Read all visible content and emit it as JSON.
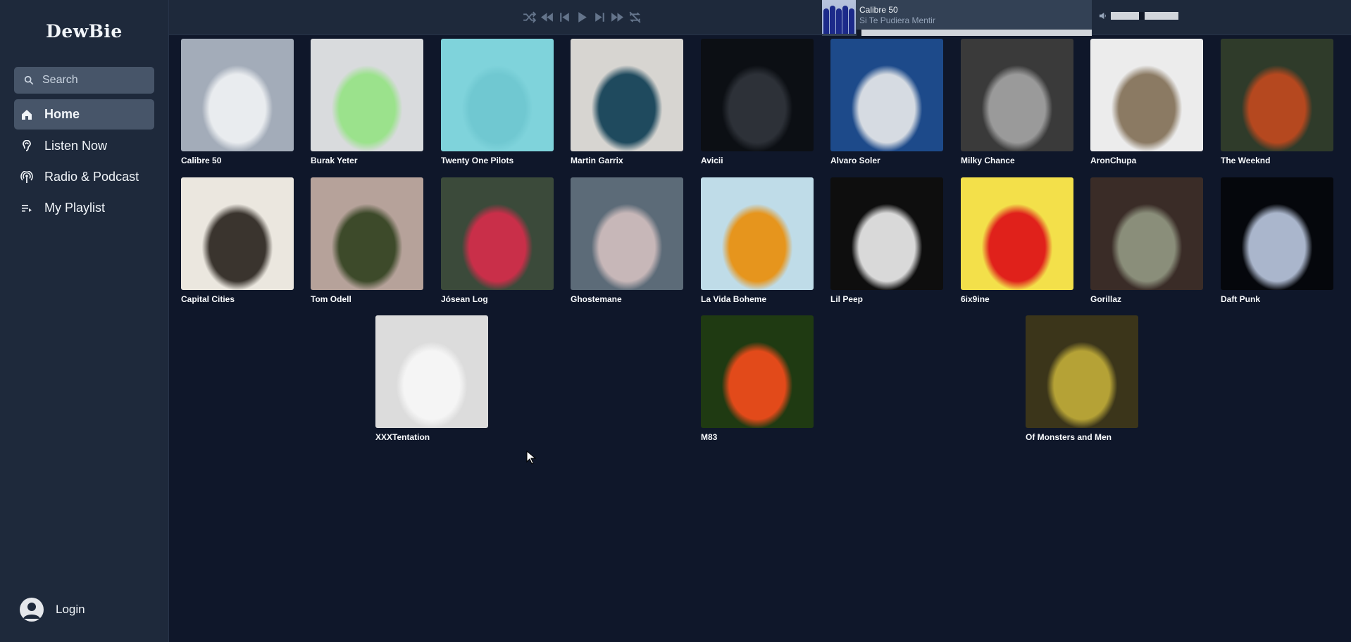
{
  "app": {
    "logo": "DewBie"
  },
  "sidebar": {
    "search_placeholder": "Search",
    "items": [
      {
        "label": "Home",
        "icon": "home-icon",
        "active": true
      },
      {
        "label": "Listen Now",
        "icon": "listen-icon",
        "active": false
      },
      {
        "label": "Radio & Podcast",
        "icon": "radio-icon",
        "active": false
      },
      {
        "label": "My Playlist",
        "icon": "playlist-icon",
        "active": false
      }
    ],
    "login_label": "Login"
  },
  "player": {
    "controls": [
      "shuffle-icon",
      "rewind-icon",
      "previous-icon",
      "play-icon",
      "next-icon",
      "fast-forward-icon",
      "repeat-off-icon"
    ],
    "now_playing": {
      "artist": "Calibre 50",
      "track": "Si Te Pudiera Mentir",
      "progress": 0.02
    },
    "volume": 0.45
  },
  "artists": [
    {
      "name": "Calibre 50",
      "colors": [
        "#a3acb9",
        "#e9ecef"
      ]
    },
    {
      "name": "Burak Yeter",
      "colors": [
        "#d9dbdd",
        "#9be28c"
      ]
    },
    {
      "name": "Twenty One Pilots",
      "colors": [
        "#7fd3db",
        "#70c8d1"
      ]
    },
    {
      "name": "Martin Garrix",
      "colors": [
        "#d7d5d1",
        "#1f4a5e"
      ]
    },
    {
      "name": "Avicii",
      "colors": [
        "#0c0f14",
        "#2d3138"
      ]
    },
    {
      "name": "Alvaro Soler",
      "colors": [
        "#1d4a8a",
        "#d6dbe2"
      ]
    },
    {
      "name": "Milky Chance",
      "colors": [
        "#3a3a3a",
        "#9a9a9a"
      ]
    },
    {
      "name": "AronChupa",
      "colors": [
        "#ececec",
        "#8b7a63"
      ]
    },
    {
      "name": "The Weeknd",
      "colors": [
        "#2f3b2a",
        "#b5481f"
      ]
    },
    {
      "name": "Capital Cities",
      "colors": [
        "#ebe7df",
        "#3a342e"
      ]
    },
    {
      "name": "Tom Odell",
      "colors": [
        "#b6a29a",
        "#3d4a2a"
      ]
    },
    {
      "name": "Jósean Log",
      "colors": [
        "#3b4a3a",
        "#c92f49"
      ]
    },
    {
      "name": "Ghostemane",
      "colors": [
        "#5c6b78",
        "#c7b7b8"
      ]
    },
    {
      "name": "La Vida Boheme",
      "colors": [
        "#bfdce8",
        "#e6951d"
      ]
    },
    {
      "name": "Lil Peep",
      "colors": [
        "#0e0e0e",
        "#d9d9d9"
      ]
    },
    {
      "name": "6ix9ine",
      "colors": [
        "#f3e04a",
        "#e0211b"
      ]
    },
    {
      "name": "Gorillaz",
      "colors": [
        "#3a2c27",
        "#8a8e7a"
      ]
    },
    {
      "name": "Daft Punk",
      "colors": [
        "#05070c",
        "#aab6cc"
      ]
    },
    {
      "name": "XXXTentation",
      "colors": [
        "#dcdcdc",
        "#f5f5f5"
      ]
    },
    {
      "name": "M83",
      "colors": [
        "#1f3a12",
        "#e24a1a"
      ]
    },
    {
      "name": "Of Monsters and Men",
      "colors": [
        "#3b351a",
        "#b5a236"
      ]
    }
  ]
}
